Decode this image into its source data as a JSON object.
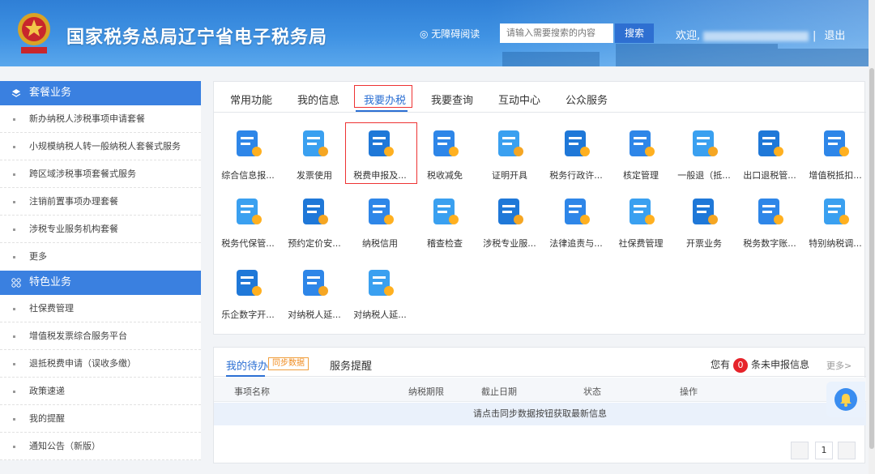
{
  "header": {
    "title": "国家税务总局辽宁省电子税务局",
    "accessibility": "◎ 无障碍阅读",
    "search_placeholder": "请输入需要搜索的内容",
    "search_button": "搜索",
    "welcome": "欢迎,",
    "separator": "|",
    "logout": "退出"
  },
  "sidebar": {
    "sections": [
      {
        "title": "套餐业务",
        "icon": "layers-icon",
        "items": [
          "新办纳税人涉税事项申请套餐",
          "小规模纳税人转一般纳税人套餐式服务",
          "跨区域涉税事项套餐式服务",
          "注销前置事项办理套餐",
          "涉税专业服务机构套餐",
          "更多"
        ]
      },
      {
        "title": "特色业务",
        "icon": "grid-icon",
        "items": [
          "社保费管理",
          "增值税发票综合服务平台",
          "退抵税费申请（误收多缴）",
          "政策速递",
          "我的提醒",
          "通知公告（新版）"
        ]
      }
    ]
  },
  "main": {
    "tabs": [
      "常用功能",
      "我的信息",
      "我要办税",
      "我要查询",
      "互动中心",
      "公众服务"
    ],
    "active_tab": "我要办税",
    "grid": [
      [
        "综合信息报...",
        "发票使用",
        "税费申报及...",
        "税收减免",
        "证明开具",
        "税务行政许...",
        "核定管理",
        "一般退（抵...",
        "出口退税管...",
        "增值税抵扣..."
      ],
      [
        "税务代保管...",
        "预约定价安...",
        "纳税信用",
        "稽查检查",
        "涉税专业服...",
        "法律追责与...",
        "社保费管理",
        "开票业务",
        "税务数字账...",
        "特别纳税调..."
      ],
      [
        "乐企数字开...",
        "对纳税人延...",
        "对纳税人延..."
      ]
    ],
    "highlighted_item": "税费申报及..."
  },
  "todo": {
    "tab1": "我的待办",
    "sync_tag": "同步数据",
    "tab2": "服务提醒",
    "count_prefix": "您有",
    "count": "0",
    "count_suffix": "条未申报信息",
    "more": "更多>",
    "columns": [
      "事项名称",
      "纳税期限",
      "截止日期",
      "状态",
      "操作"
    ],
    "empty_message": "请点击同步数据按钮获取最新信息",
    "page": "1"
  },
  "colors": {
    "brand_blue": "#3a80e0",
    "highlight_red": "#e33333",
    "badge_red": "#e6232a"
  }
}
